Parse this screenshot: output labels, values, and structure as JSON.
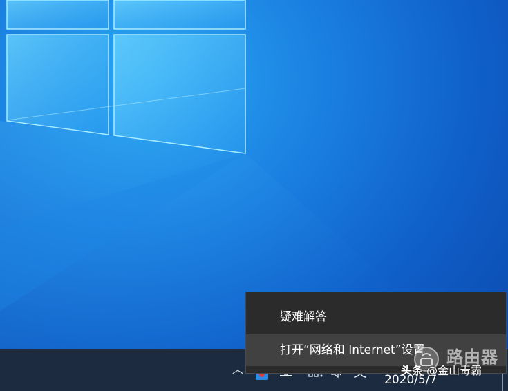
{
  "colors": {
    "desktop_light": "#2aa8f5",
    "desktop_dark": "#0b45a8",
    "taskbar": "#1c2b3f",
    "menu_bg": "#2b2b2b",
    "menu_hover": "#414141",
    "menu_text": "#ffffff"
  },
  "context_menu": {
    "items": [
      {
        "label": "疑难解答"
      },
      {
        "label": "打开“网络和 Internet”设置"
      }
    ]
  },
  "taskbar": {
    "tray_chevron_icon": "chevron-up-icon",
    "icons": [
      "app-icon",
      "network-icon",
      "display-icon",
      "volume-icon"
    ],
    "ime_label": "英",
    "date": "2020/5/7"
  },
  "watermark": {
    "badge_icon": "router-badge-icon",
    "brand": "路由器",
    "source": "头条",
    "author": "@金山毒霸"
  }
}
